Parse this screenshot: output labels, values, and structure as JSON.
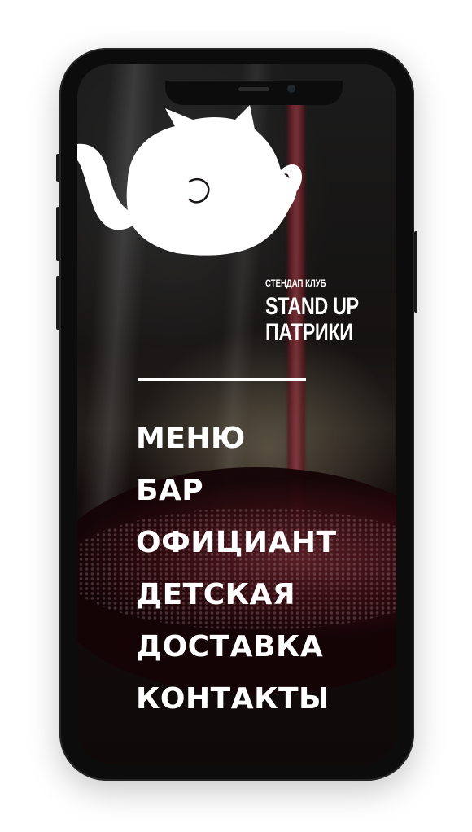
{
  "club": {
    "subtitle": "СТЕНДАП КЛУБ",
    "name_line1": "STAND UP",
    "name_line2": "ПАТРИКИ"
  },
  "menu": {
    "items": [
      {
        "label": "МЕНЮ"
      },
      {
        "label": "БАР"
      },
      {
        "label": "ОФИЦИАНТ"
      },
      {
        "label": "ДЕТСКАЯ"
      },
      {
        "label": "ДОСТАВКА"
      },
      {
        "label": "КОНТАКТЫ"
      }
    ]
  },
  "icons": {
    "logo": "cat-teapot-logo"
  },
  "colors": {
    "text": "#ffffff",
    "wine": "#7a1e28",
    "phone_frame": "#0c0c0c"
  }
}
